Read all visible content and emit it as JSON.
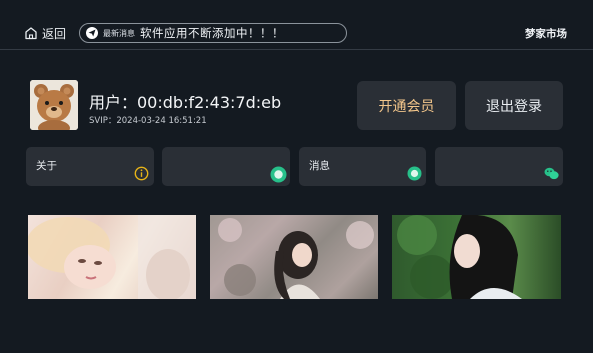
{
  "topbar": {
    "back_label": "返回",
    "news_tag": "最新消息",
    "news_text": "软件应用不断添加中！！！",
    "store_title": "梦家市场"
  },
  "profile": {
    "user_label": "用户：00:db:f2:43:7d:eb",
    "svip_label": "SVIP：2024-03-24 16:51:21"
  },
  "actions": {
    "vip_label": "开通会员",
    "logout_label": "退出登录"
  },
  "cards": [
    {
      "label": "关于",
      "icon": "info-icon"
    },
    {
      "label": "",
      "icon": "chat-bubble-icon"
    },
    {
      "label": "消息",
      "icon": "chat-bubble-icon"
    },
    {
      "label": "",
      "icon": "wechat-icon"
    }
  ],
  "colors": {
    "background": "#141a21",
    "card": "#2a2f36",
    "vip_text": "#f3c68b",
    "icon_green": "#27c08a",
    "info_yellow": "#e7b418"
  }
}
